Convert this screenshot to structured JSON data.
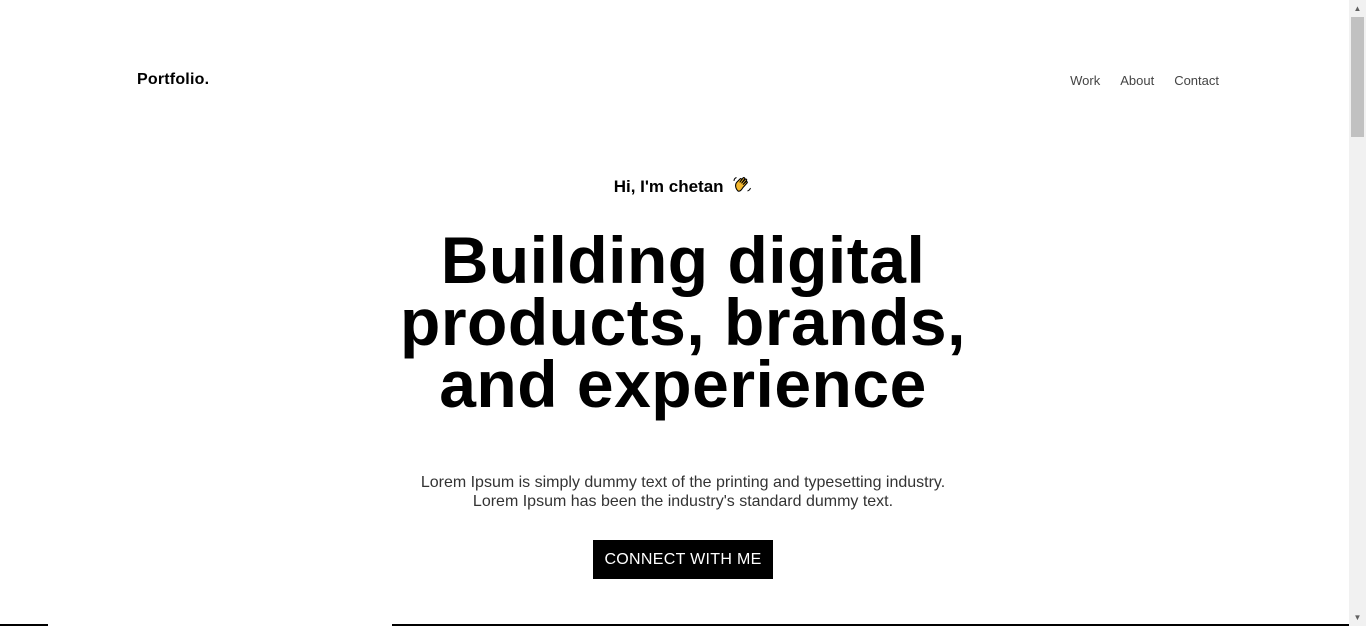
{
  "header": {
    "logo": "Portfolio.",
    "nav": [
      {
        "label": "Work"
      },
      {
        "label": "About"
      },
      {
        "label": "Contact"
      }
    ]
  },
  "hero": {
    "greeting": "Hi, I'm chetan",
    "greeting_icon": "waving-hand-icon",
    "headline_lines": [
      "Building digital",
      "products, brands,",
      "and experience"
    ],
    "intro": "Lorem Ipsum is simply dummy text of the printing and typesetting industry. Lorem Ipsum has been the industry's standard dummy text.",
    "cta_label": "CONNECT WITH ME"
  },
  "colors": {
    "background": "#ffffff",
    "text": "#000000",
    "cta_background": "#000000",
    "cta_text": "#ffffff",
    "nav_text": "#444444"
  }
}
